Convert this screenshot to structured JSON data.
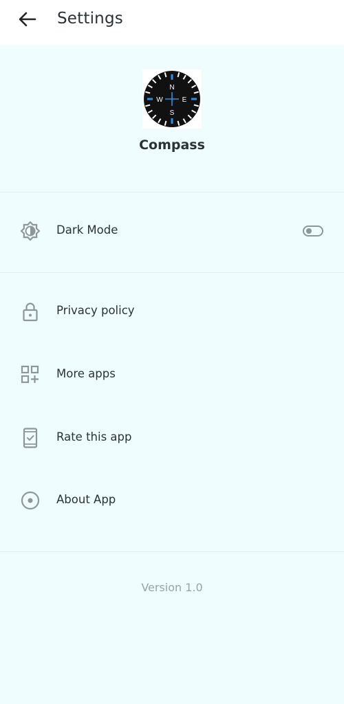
{
  "appbar": {
    "title": "Settings",
    "back_icon": "arrow-left-icon"
  },
  "header": {
    "app_name": "Compass",
    "logo": {
      "icon": "compass-icon",
      "directions": [
        "N",
        "E",
        "S",
        "W"
      ],
      "accent": "#2f8fe0",
      "dial_color": "#111111"
    }
  },
  "settings": {
    "dark_mode": {
      "label": "Dark Mode",
      "icon": "brightness-icon",
      "enabled": false
    }
  },
  "menu": {
    "privacy": {
      "label": "Privacy policy",
      "icon": "lock-icon"
    },
    "more_apps": {
      "label": "More apps",
      "icon": "grid-plus-icon"
    },
    "rate": {
      "label": "Rate this app",
      "icon": "phone-check-icon"
    },
    "about": {
      "label": "About App",
      "icon": "radio-dot-icon"
    }
  },
  "footer": {
    "version": "Version 1.0"
  },
  "colors": {
    "background": "#effdfe",
    "appbar": "#ffffff",
    "icon_gray": "#8e969a",
    "text": "#2a3236"
  }
}
